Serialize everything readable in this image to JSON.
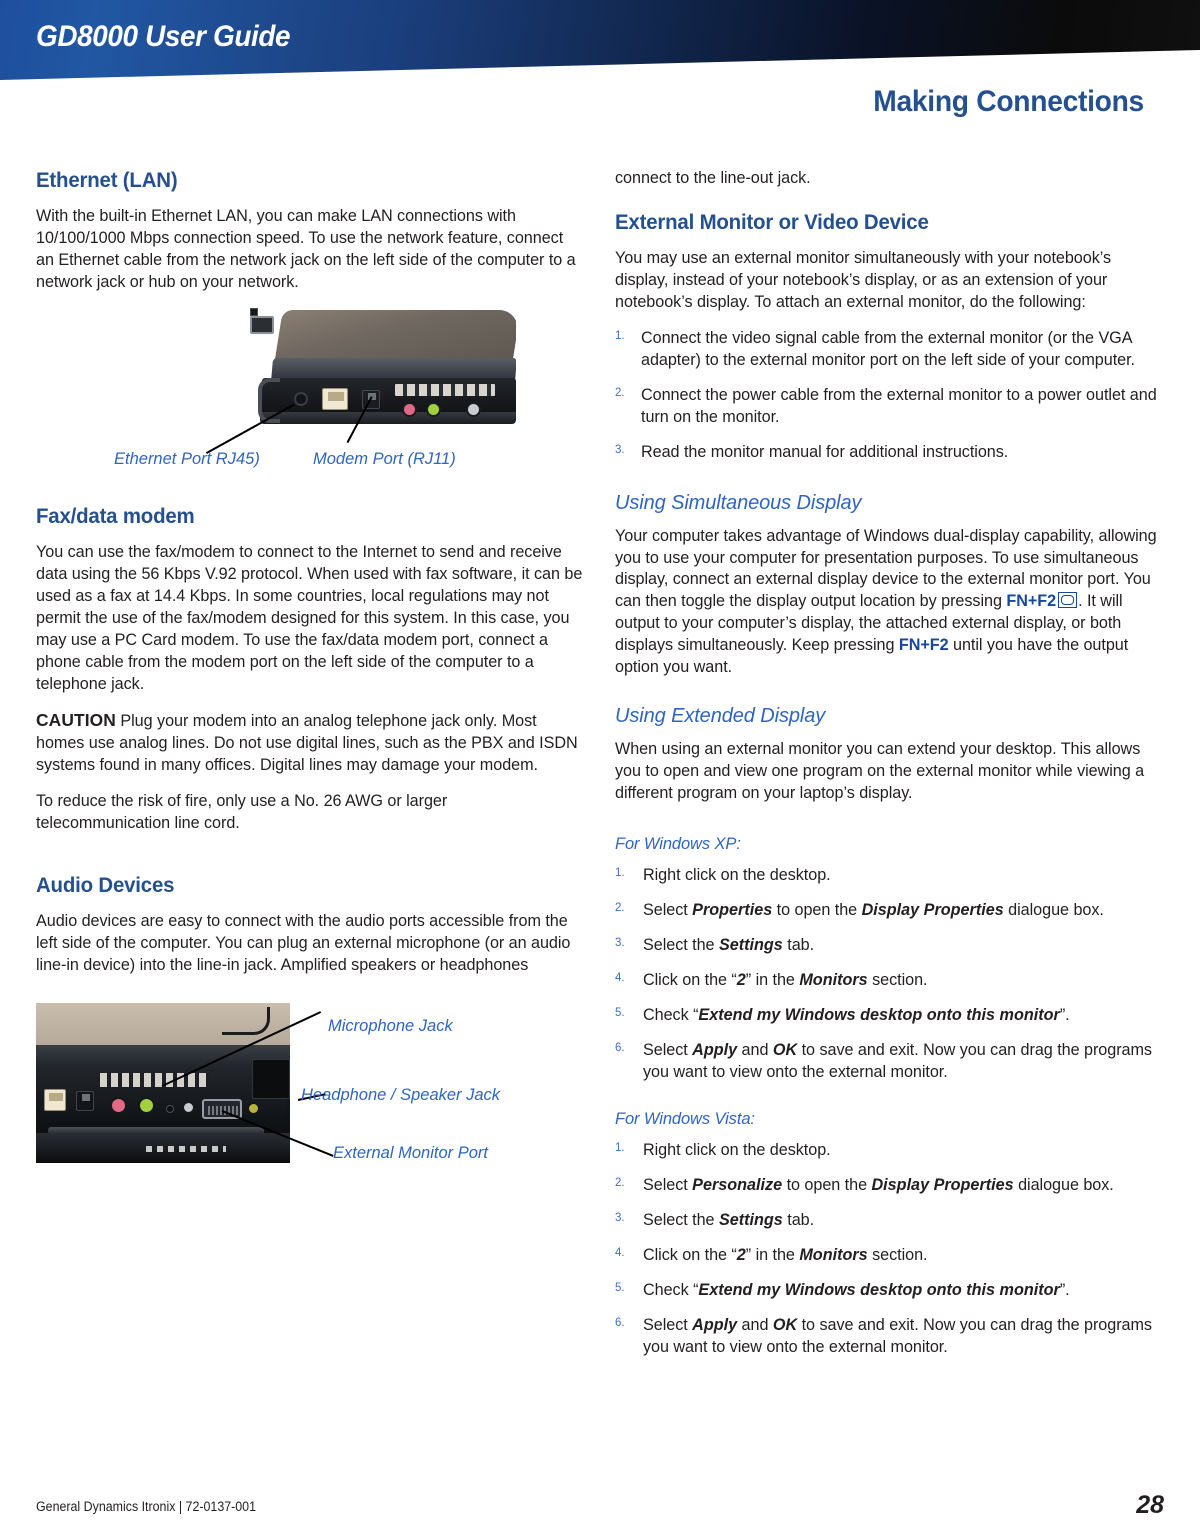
{
  "header": {
    "product_title": "GD8000 User Guide",
    "chapter_title": "Making Connections"
  },
  "left_column": {
    "section1": {
      "heading": "Ethernet (LAN)",
      "paragraph": "With the built-in Ethernet LAN, you can make LAN connections with 10/100/1000 Mbps connection speed.  To use the network feature, connect an Ethernet cable from the network jack on the left side of the computer to a network jack or hub on your network."
    },
    "figure1": {
      "label_left": "Ethernet Port RJ45)",
      "label_right": "Modem Port (RJ11)",
      "alt": "photo of left side of notebook showing ethernet and modem ports"
    },
    "section2": {
      "heading": "Fax/data modem",
      "paragraph1": "You can use the fax/modem to connect to the Internet to send and receive data using the 56 Kbps V.92 protocol.  When used with fax software, it can be used as a fax at 14.4 Kbps.  In some countries, local regulations may not permit the use of the fax/modem designed for this system. In this case, you may use a PC Card modem.  To use the fax/data modem port, connect a phone cable from the modem port on the left side of the computer to a telephone jack.",
      "caution_label": "CAUTION",
      "caution_text": "Plug your modem into an analog telephone jack only.  Most homes use analog lines.  Do not use digital lines, such as the PBX and ISDN systems found in many offices.  Digital lines may damage your modem.",
      "paragraph3": "To reduce the risk of fire, only use a No. 26 AWG or larger telecommunication line cord."
    },
    "section3": {
      "heading": "Audio Devices",
      "paragraph": "Audio devices are easy to connect with the audio ports accessible from the left side of the computer.  You can plug an external microphone (or an audio line-in device) into the line-in jack.  Amplified speakers or headphones"
    },
    "figure2": {
      "label1": "Microphone Jack",
      "label2": "Headphone / Speaker Jack",
      "label3": "External Monitor Port",
      "alt": "photo of left side audio ports and external monitor port"
    }
  },
  "right_column": {
    "continuation": "connect to the line-out jack.",
    "section1": {
      "heading": "External Monitor or Video Device",
      "paragraph": "You may use an external monitor simultaneously with your notebook’s display, instead of your notebook’s display, or as an extension of your notebook’s display.  To attach an external monitor, do the following:",
      "steps": [
        {
          "num": "1.",
          "text": "Connect the video signal cable from the external monitor (or the VGA adapter) to the external monitor port on the left side of your computer."
        },
        {
          "num": "2.",
          "text": "Connect the power cable from the external monitor to a power outlet and turn on the monitor."
        },
        {
          "num": "3.",
          "text": "Read the monitor manual for additional instructions."
        }
      ]
    },
    "section2": {
      "heading": "Using Simultaneous Display",
      "text_part1": "Your computer takes advantage of Windows dual-display capability, allowing you to use your computer for presentation purposes.  To use simultaneous display, connect an external display device to the external monitor port.  You can then toggle the display output location by pressing ",
      "fn_key_1": "FN+F2",
      "text_part2": ".  It will output to your computer’s display, the attached external display, or both displays simultaneously.  Keep pressing ",
      "fn_key_2": "FN+F2",
      "text_part3": " until you have the output option you want."
    },
    "section3": {
      "heading": "Using Extended Display",
      "paragraph": "When using an external monitor you can extend your desktop. This allows you to open and view one program on the external monitor while viewing a different program on your laptop’s display.",
      "xp_label": "For Windows XP:",
      "xp_steps": [
        {
          "num": "1.",
          "pre": "Right click on the desktop.",
          "bold1": "",
          "mid": "",
          "bold2": "",
          "post": ""
        },
        {
          "num": "2.",
          "pre": "Select ",
          "bold1": "Properties",
          "mid": " to open the ",
          "bold2": "Display Properties",
          "post": " dialogue box."
        },
        {
          "num": "3.",
          "pre": "Select the ",
          "bold1": "Settings",
          "mid": " tab.",
          "bold2": "",
          "post": ""
        },
        {
          "num": "4.",
          "pre": "Click on the “",
          "bold1": "2",
          "mid": "” in the ",
          "bold2": "Monitors",
          "post": " section."
        },
        {
          "num": "5.",
          "pre": "Check “",
          "bold1": "Extend my Windows desktop onto this monitor",
          "mid": "”.",
          "bold2": "",
          "post": ""
        },
        {
          "num": "6.",
          "pre": "Select ",
          "bold1": "Apply",
          "mid": " and ",
          "bold2": "OK",
          "post": " to save and exit.  Now you can drag the programs you want to view onto the external monitor."
        }
      ],
      "vista_label": "For Windows Vista:",
      "vista_steps": [
        {
          "num": "1.",
          "pre": "Right click on the desktop.",
          "bold1": "",
          "mid": "",
          "bold2": "",
          "post": ""
        },
        {
          "num": "2.",
          "pre": "Select ",
          "bold1": "Personalize",
          "mid": " to open the ",
          "bold2": "Display Properties",
          "post": " dialogue box."
        },
        {
          "num": "3.",
          "pre": "Select the ",
          "bold1": "Settings",
          "mid": " tab.",
          "bold2": "",
          "post": ""
        },
        {
          "num": "4.",
          "pre": "Click on the “",
          "bold1": "2",
          "mid": "” in the ",
          "bold2": "Monitors",
          "post": " section."
        },
        {
          "num": "5.",
          "pre": "Check “",
          "bold1": "Extend my Windows desktop onto this monitor",
          "mid": "”.",
          "bold2": "",
          "post": ""
        },
        {
          "num": "6.",
          "pre": "Select ",
          "bold1": "Apply",
          "mid": " and ",
          "bold2": "OK",
          "post": " to save and exit.  Now you can drag the programs you want to view onto the external monitor."
        }
      ]
    }
  },
  "footer": {
    "company_line": "General Dynamics Itronix | 72-0137-001",
    "page_number": "28"
  },
  "colors": {
    "heading_blue": "#24508f",
    "subheading_blue": "#2f65c0",
    "fn_key_blue": "#17479e",
    "list_number_blue": "#3d6fbd",
    "body_text": "#231f20",
    "banner_start": "#1d4f9e",
    "banner_end": "#101010"
  }
}
